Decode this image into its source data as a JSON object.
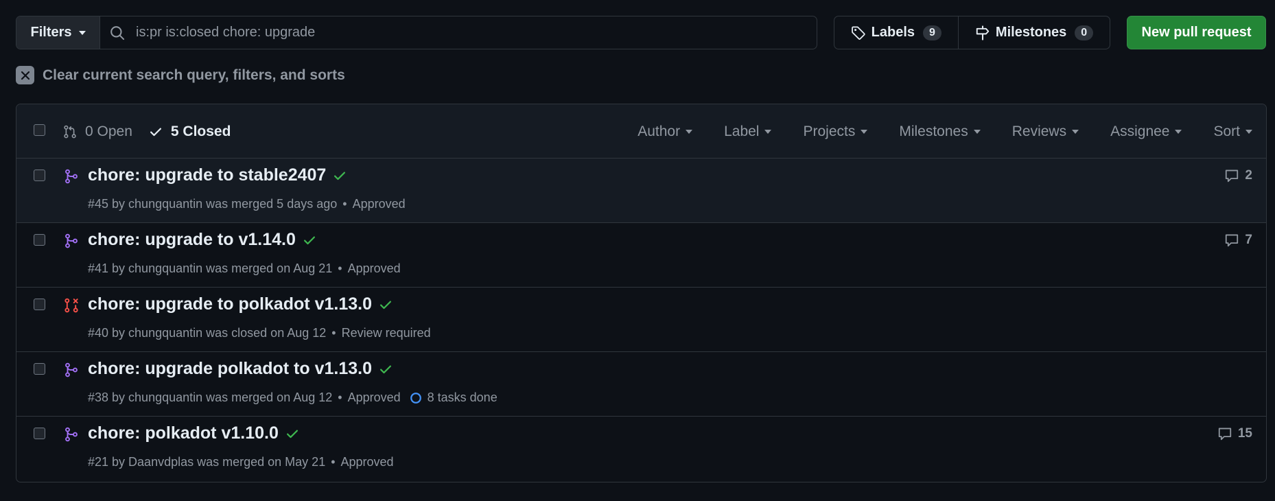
{
  "toolbar": {
    "filters_label": "Filters",
    "search_value": "is:pr is:closed chore: upgrade",
    "labels_label": "Labels",
    "labels_count": "9",
    "milestones_label": "Milestones",
    "milestones_count": "0",
    "new_pr_label": "New pull request"
  },
  "clear_filters": "Clear current search query, filters, and sorts",
  "header": {
    "open_label": "0 Open",
    "closed_label": "5 Closed",
    "filters": [
      "Author",
      "Label",
      "Projects",
      "Milestones",
      "Reviews",
      "Assignee",
      "Sort"
    ]
  },
  "colors": {
    "merged": "#a371f7",
    "closed": "#f85149",
    "check": "#3fb950",
    "primary_button": "#238636",
    "task_ring": "#4493f8"
  },
  "pulls": [
    {
      "title": "chore: upgrade to stable2407",
      "state": "merged",
      "meta": "#45 by chungquantin was merged 5 days ago",
      "review": "Approved",
      "tasks": null,
      "comments": "2"
    },
    {
      "title": "chore: upgrade to v1.14.0",
      "state": "merged",
      "meta": "#41 by chungquantin was merged on Aug 21",
      "review": "Approved",
      "tasks": null,
      "comments": "7"
    },
    {
      "title": "chore: upgrade to polkadot v1.13.0",
      "state": "closed",
      "meta": "#40 by chungquantin was closed on Aug 12",
      "review": "Review required",
      "tasks": null,
      "comments": null
    },
    {
      "title": "chore: upgrade polkadot to v1.13.0",
      "state": "merged",
      "meta": "#38 by chungquantin was merged on Aug 12",
      "review": "Approved",
      "tasks": "8 tasks done",
      "comments": null
    },
    {
      "title": "chore: polkadot v1.10.0",
      "state": "merged",
      "meta": "#21 by Daanvdplas was merged on May 21",
      "review": "Approved",
      "tasks": null,
      "comments": "15"
    }
  ]
}
